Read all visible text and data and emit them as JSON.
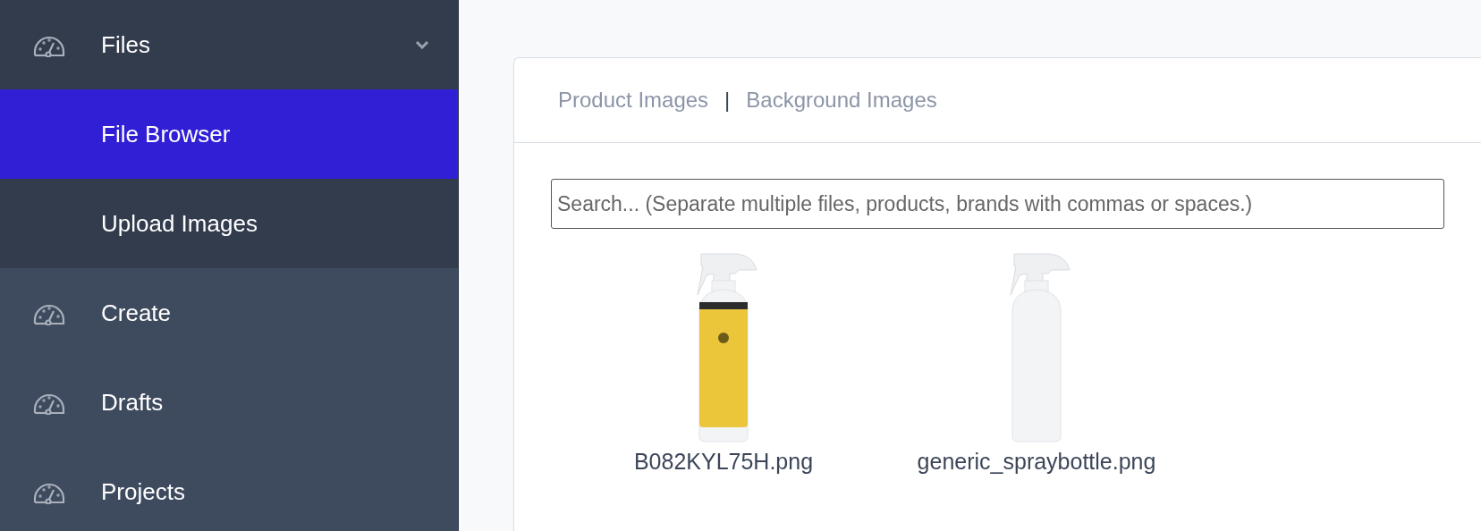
{
  "sidebar": {
    "items": [
      {
        "label": "Files",
        "expanded": true,
        "children": [
          {
            "label": "File Browser",
            "selected": true
          },
          {
            "label": "Upload Images",
            "selected": false
          }
        ]
      },
      {
        "label": "Create",
        "expanded": false
      },
      {
        "label": "Drafts",
        "expanded": false
      },
      {
        "label": "Projects",
        "expanded": false
      }
    ]
  },
  "tabs": {
    "items": [
      {
        "label": "Product Images"
      },
      {
        "label": "Background Images"
      }
    ],
    "separator": "|"
  },
  "search": {
    "placeholder": "Search... (Separate multiple files, products, brands with commas or spaces.)"
  },
  "files": [
    {
      "name": "B082KYL75H.png",
      "kind": "yellow"
    },
    {
      "name": "generic_spraybottle.png",
      "kind": "plain"
    }
  ]
}
